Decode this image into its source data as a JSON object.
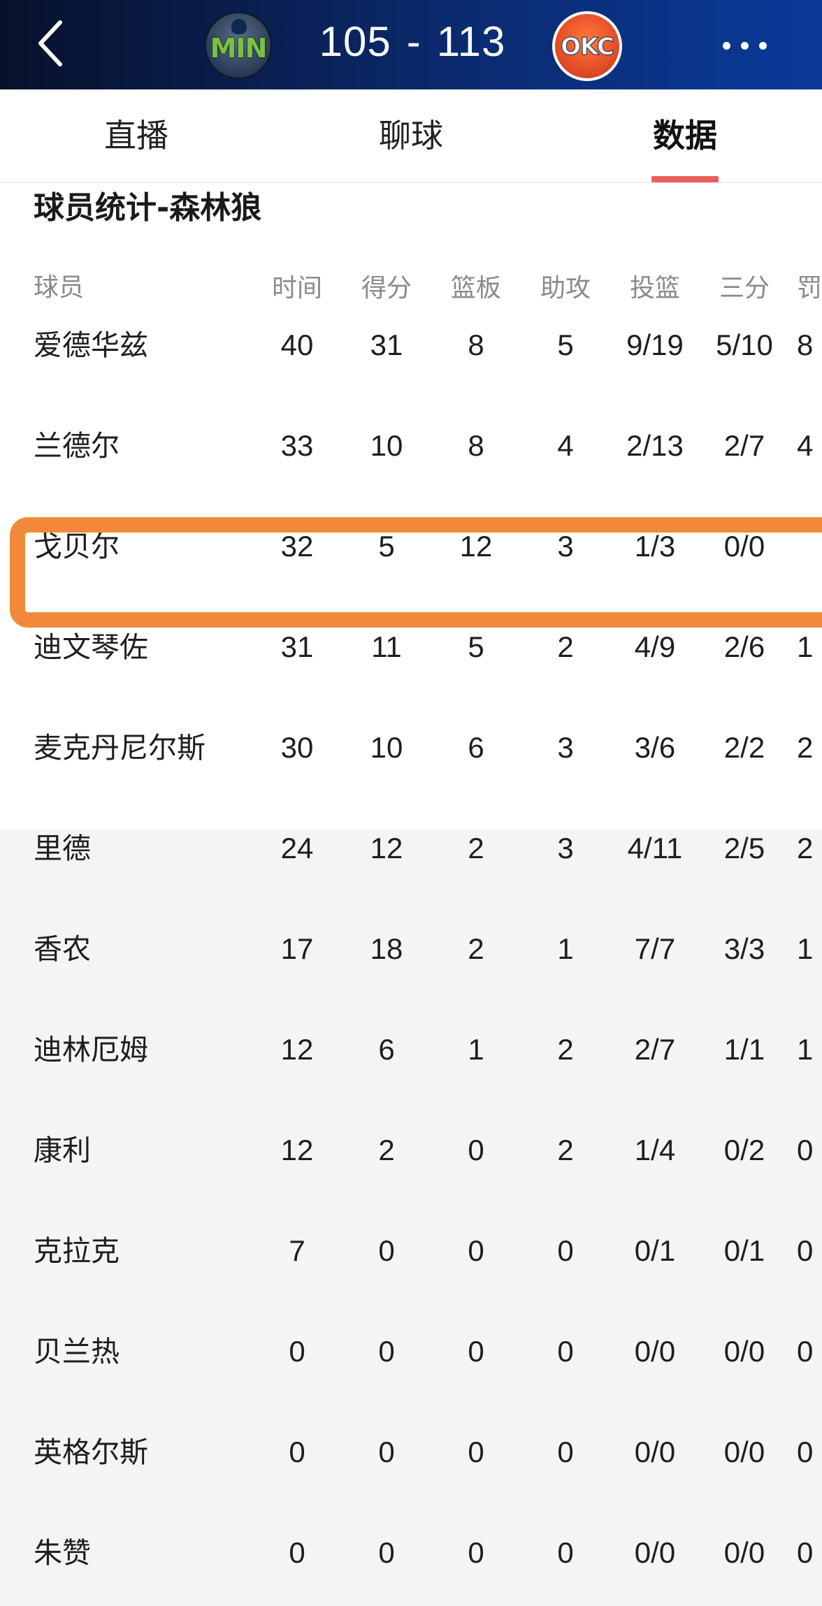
{
  "header": {
    "home_team": "MIN",
    "away_team": "OKC",
    "home_score": "105",
    "separator": "-",
    "away_score": "113"
  },
  "tabs": [
    {
      "label": "直播"
    },
    {
      "label": "聊球"
    },
    {
      "label": "数据",
      "active": true
    }
  ],
  "section_title": "球员统计-森林狼",
  "columns": [
    "球员",
    "时间",
    "得分",
    "篮板",
    "助攻",
    "投篮",
    "三分",
    "罚"
  ],
  "players": [
    {
      "name": "爱德华兹",
      "min": "40",
      "pts": "31",
      "reb": "8",
      "ast": "5",
      "fg": "9/19",
      "tp": "5/10",
      "ft": "8"
    },
    {
      "name": "兰德尔",
      "min": "33",
      "pts": "10",
      "reb": "8",
      "ast": "4",
      "fg": "2/13",
      "tp": "2/7",
      "ft": "4"
    },
    {
      "name": "戈贝尔",
      "min": "32",
      "pts": "5",
      "reb": "12",
      "ast": "3",
      "fg": "1/3",
      "tp": "0/0",
      "ft": ""
    },
    {
      "name": "迪文琴佐",
      "min": "31",
      "pts": "11",
      "reb": "5",
      "ast": "2",
      "fg": "4/9",
      "tp": "2/6",
      "ft": "1"
    },
    {
      "name": "麦克丹尼尔斯",
      "min": "30",
      "pts": "10",
      "reb": "6",
      "ast": "3",
      "fg": "3/6",
      "tp": "2/2",
      "ft": "2"
    },
    {
      "name": "里德",
      "min": "24",
      "pts": "12",
      "reb": "2",
      "ast": "3",
      "fg": "4/11",
      "tp": "2/5",
      "ft": "2"
    },
    {
      "name": "香农",
      "min": "17",
      "pts": "18",
      "reb": "2",
      "ast": "1",
      "fg": "7/7",
      "tp": "3/3",
      "ft": "1"
    },
    {
      "name": "迪林厄姆",
      "min": "12",
      "pts": "6",
      "reb": "1",
      "ast": "2",
      "fg": "2/7",
      "tp": "1/1",
      "ft": "1"
    },
    {
      "name": "康利",
      "min": "12",
      "pts": "2",
      "reb": "0",
      "ast": "2",
      "fg": "1/4",
      "tp": "0/2",
      "ft": "0"
    },
    {
      "name": "克拉克",
      "min": "7",
      "pts": "0",
      "reb": "0",
      "ast": "0",
      "fg": "0/1",
      "tp": "0/1",
      "ft": "0"
    },
    {
      "name": "贝兰热",
      "min": "0",
      "pts": "0",
      "reb": "0",
      "ast": "0",
      "fg": "0/0",
      "tp": "0/0",
      "ft": "0"
    },
    {
      "name": "英格尔斯",
      "min": "0",
      "pts": "0",
      "reb": "0",
      "ast": "0",
      "fg": "0/0",
      "tp": "0/0",
      "ft": "0"
    },
    {
      "name": "朱赞",
      "min": "0",
      "pts": "0",
      "reb": "0",
      "ast": "0",
      "fg": "0/0",
      "tp": "0/0",
      "ft": "0"
    }
  ],
  "highlighted_player_index": 2,
  "colors": {
    "header_bg": "#0b2a6e",
    "tab_underline": "#e8605a",
    "highlight_border": "#f08a3a",
    "bench_bg": "#f4f4f4"
  },
  "icons": {
    "back": "chevron-left-icon",
    "more": "more-dots-icon"
  }
}
